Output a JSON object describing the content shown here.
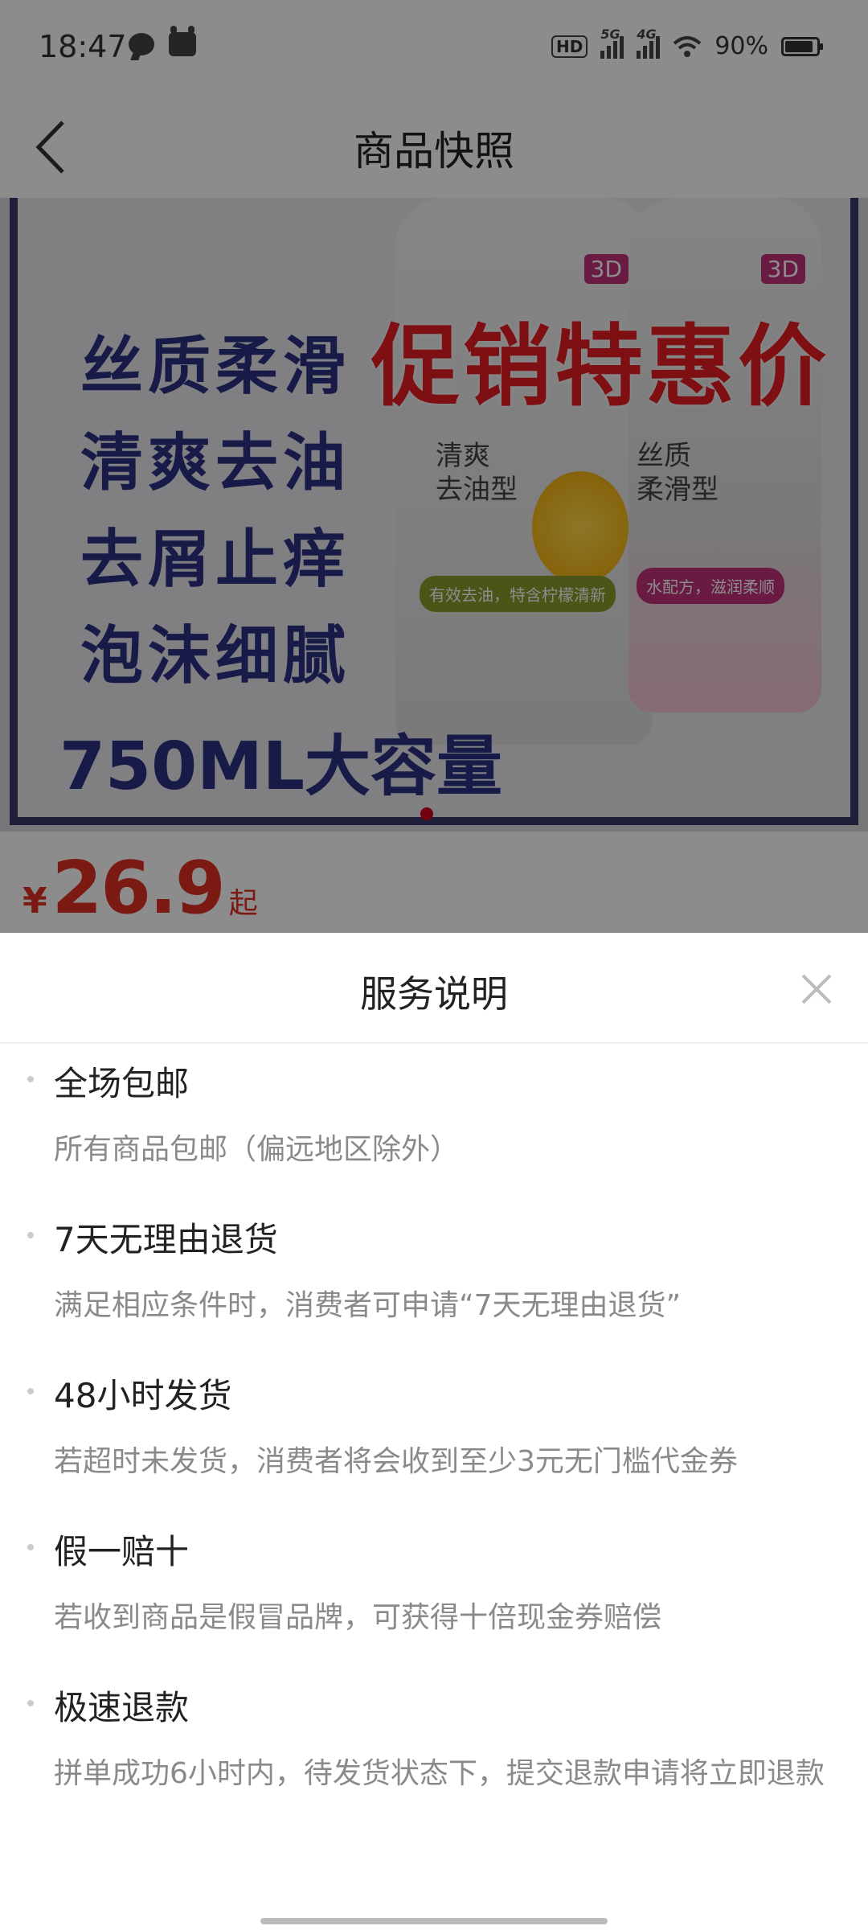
{
  "status_bar": {
    "time": "18:47",
    "icons_left": [
      "chat-bubble-icon",
      "cow-icon"
    ],
    "network": {
      "hd_badge": "HD",
      "sim1": "5G",
      "sim2": "4G"
    },
    "battery_percent": "90%",
    "battery_level": 0.9
  },
  "header": {
    "back_icon": "chevron-left-icon",
    "title": "商品快照"
  },
  "banner": {
    "features": [
      "丝质柔滑",
      "清爽去油",
      "去屑止痒",
      "泡沫细腻"
    ],
    "promo": "促销特惠价",
    "capacity": "750ML大容量",
    "bottle_1": {
      "tag": "3D",
      "label_line1": "清爽",
      "label_line2": "去油型",
      "strip": "有效去油，特含柠檬清新"
    },
    "bottle_2": {
      "tag": "3D",
      "label_line1": "丝质",
      "label_line2": "柔滑型",
      "strip": "水配方，滋润柔顺"
    },
    "carousel": {
      "current": 1,
      "total": 1
    }
  },
  "price": {
    "currency": "¥",
    "amount": "26.9",
    "suffix": "起"
  },
  "sheet": {
    "title": "服务说明",
    "close_icon": "close-icon",
    "items": [
      {
        "title": "全场包邮",
        "desc": "所有商品包邮（偏远地区除外）"
      },
      {
        "title": "7天无理由退货",
        "desc": "满足相应条件时，消费者可申请“7天无理由退货”"
      },
      {
        "title": "48小时发货",
        "desc": "若超时未发货，消费者将会收到至少3元无门槛代金券"
      },
      {
        "title": "假一赔十",
        "desc": "若收到商品是假冒品牌，可获得十倍现金券赔偿"
      },
      {
        "title": "极速退款",
        "desc": "拼单成功6小时内，待发货状态下，提交退款申请将立即退款"
      }
    ]
  },
  "colors": {
    "price_red": "#e02e24",
    "banner_text_blue": "#2d3184",
    "promo_red": "#e51c23",
    "secondary_text": "#8a8a8a"
  }
}
